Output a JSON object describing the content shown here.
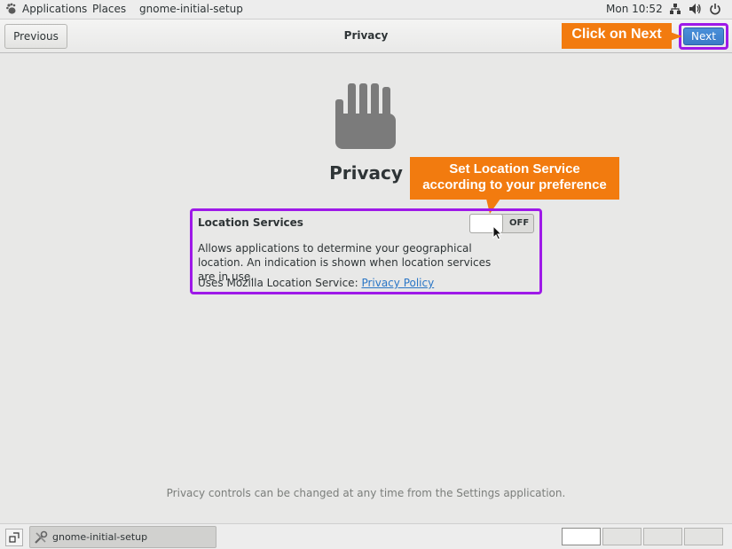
{
  "topbar": {
    "applications": "Applications",
    "places": "Places",
    "app_name": "gnome-initial-setup",
    "clock": "Mon 10:52",
    "tray_icons": [
      "network-icon",
      "volume-icon",
      "power-icon"
    ]
  },
  "header": {
    "previous_label": "Previous",
    "title": "Privacy",
    "next_label": "Next"
  },
  "callouts": {
    "next": "Click on Next",
    "location_line1": "Set Location Service",
    "location_line2": "according to your preference"
  },
  "main": {
    "icon": "privacy-hand-icon",
    "title": "Privacy",
    "location": {
      "label": "Location Services",
      "switch_state": "OFF",
      "description": "Allows applications to determine your geographical location. An indication is shown when location services are in use.",
      "uses_prefix": "Uses Mozilla Location Service: ",
      "policy_link": "Privacy Policy"
    },
    "footer_note": "Privacy controls can be changed at any time from the Settings application."
  },
  "taskbar": {
    "window_label": "gnome-initial-setup",
    "workspaces": 4,
    "active_workspace": 1
  },
  "colors": {
    "highlight": "#9e19e8",
    "callout": "#f27b0f",
    "accent": "#4a90d9"
  }
}
